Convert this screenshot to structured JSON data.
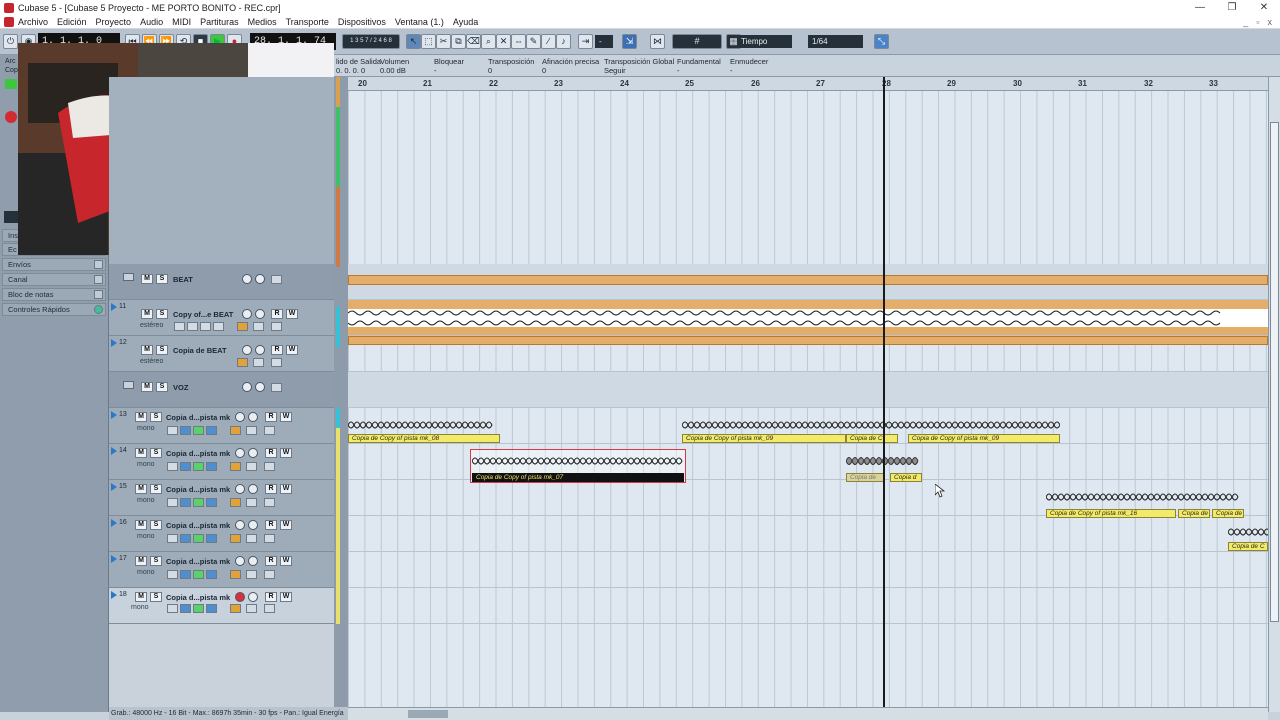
{
  "window": {
    "title": "Cubase 5 - [Cubase 5 Proyecto - ME PORTO BONITO - REC.cpr]",
    "controls": [
      "—",
      "❐",
      "✕"
    ]
  },
  "menu": [
    "Archivo",
    "Edición",
    "Proyecto",
    "Audio",
    "MIDI",
    "Partituras",
    "Medios",
    "Transporte",
    "Dispositivos",
    "Ventana (1.)",
    "Ayuda"
  ],
  "toolbar": {
    "position_left": "1. 1. 1.  0",
    "position_right": "28. 1. 1. 74",
    "snap_value": "Tiempo",
    "quantize_value": "1/64",
    "grid_select": "-"
  },
  "infoline": [
    {
      "label": "lido de Salida",
      "value": "0. 0. 0.  0"
    },
    {
      "label": "Volumen",
      "value": "0.00 dB"
    },
    {
      "label": "Bloquear",
      "value": "-"
    },
    {
      "label": "Transposición",
      "value": "0"
    },
    {
      "label": "Afinación precisa",
      "value": "0"
    },
    {
      "label": "Transposición Global",
      "value": "Seguir"
    },
    {
      "label": "Fundamental",
      "value": "-"
    },
    {
      "label": "Enmudecer",
      "value": "-"
    }
  ],
  "inspector": {
    "partial_labels": [
      "Arc",
      "Cop",
      "Ins",
      "Ec"
    ],
    "sections": [
      "Envíos",
      "Canal",
      "Bloc de notas",
      "Controles Rápidos"
    ]
  },
  "ruler": {
    "bars": [
      "20",
      "21",
      "22",
      "23",
      "24",
      "25",
      "26",
      "27",
      "28",
      "29",
      "30",
      "31",
      "32",
      "33"
    ]
  },
  "tracks": [
    {
      "num": "",
      "name": "BEAT",
      "type": "folder",
      "sub": ""
    },
    {
      "num": "11",
      "name": "Copy of...e BEAT",
      "type": "audio",
      "sub": "estéreo"
    },
    {
      "num": "12",
      "name": "Copia de BEAT",
      "type": "audio",
      "sub": "estéreo"
    },
    {
      "num": "",
      "name": "VOZ",
      "type": "folder",
      "sub": ""
    },
    {
      "num": "13",
      "name": "Copia d...pista mk",
      "type": "audio",
      "sub": "mono"
    },
    {
      "num": "14",
      "name": "Copia d...pista mk",
      "type": "audio",
      "sub": "mono"
    },
    {
      "num": "15",
      "name": "Copia d...pista mk",
      "type": "audio",
      "sub": "mono"
    },
    {
      "num": "16",
      "name": "Copia d...pista mk",
      "type": "audio",
      "sub": "mono"
    },
    {
      "num": "17",
      "name": "Copia d...pista mk",
      "type": "audio",
      "sub": "mono"
    },
    {
      "num": "18",
      "name": "Copia d...pista mk",
      "type": "audio",
      "sub": "mono"
    }
  ],
  "events": {
    "e1": "Copia de Copy of pista mk_08",
    "e2": "Copia de Copy of pista mk_09",
    "e3": "Copia de C",
    "e4": "Copia de Copy of pista mk_09",
    "e5": "Copia de Copy of pista mk_07",
    "e6": "Copia de",
    "e7": "Copia d",
    "e8": "Copia de Copy of pista mk_16",
    "e9": "Copia de",
    "e10": "Copia de",
    "e11": "Copia de C"
  },
  "track_buttons": {
    "mute": "M",
    "solo": "S",
    "read": "R",
    "write": "W"
  },
  "status": "Grab.: 48000 Hz - 16 Bit - Max.: 8697h 35min - 30 fps - Pan.: Igual Energía",
  "colors": {
    "folder_bar": "#e4ad6a",
    "event_label": "#f2ea6b",
    "accent": "#2a79c8"
  }
}
